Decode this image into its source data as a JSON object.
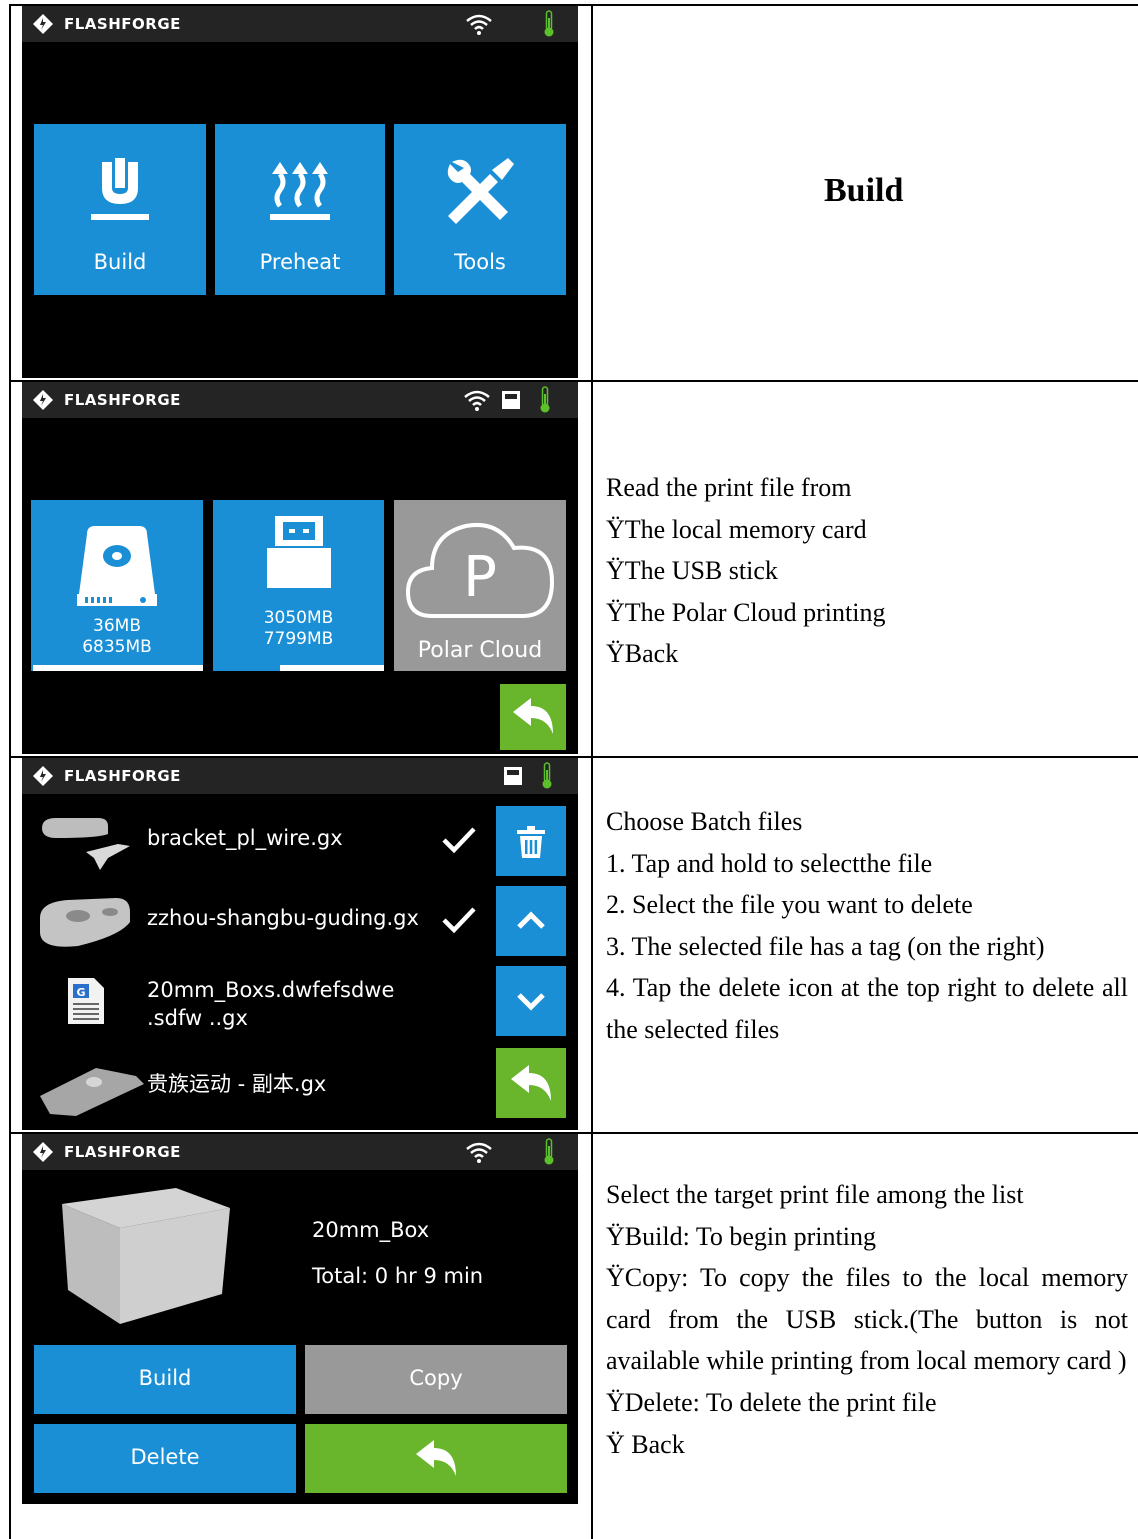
{
  "brand": "FLASHFORGE",
  "colors": {
    "blue": "#1b8fd6",
    "green": "#69b62c",
    "grey": "#999999"
  },
  "row1": {
    "tiles": [
      {
        "label": "Build",
        "icon": "build-icon"
      },
      {
        "label": "Preheat",
        "icon": "heat-icon"
      },
      {
        "label": "Tools",
        "icon": "tools-icon"
      }
    ],
    "title": "Build"
  },
  "row2": {
    "storage": [
      {
        "icon": "memory-card-icon",
        "used": "36MB",
        "total": "6835MB",
        "usage_fraction": 0.01
      },
      {
        "icon": "usb-icon",
        "used": "3050MB",
        "total": "7799MB",
        "usage_fraction": 0.39
      },
      {
        "icon": "polar-cloud-icon",
        "label": "Polar Cloud",
        "cloud_letter": "P"
      }
    ],
    "lines": [
      "Read the print file from",
      "ŸThe local memory card",
      "ŸThe USB stick",
      "ŸThe Polar Cloud printing",
      "ŸBack"
    ]
  },
  "row3": {
    "files": [
      {
        "name": "bracket_pl_wire.gx",
        "selected": true
      },
      {
        "name": "zzhou-shangbu-guding.gx",
        "selected": true
      },
      {
        "name_line1": "20mm_Boxs.dwfefsdwe",
        "name_line2": ".sdfw ..gx",
        "selected": false
      },
      {
        "name": "贵族运动 - 副本.gx",
        "selected": false
      }
    ],
    "title": "Choose Batch files",
    "steps": [
      "1. Tap and hold to selectthe file",
      "2. Select the file you want to delete",
      "3. The selected file has a tag (on the right)",
      "4. Tap the delete icon at the top right to delete all the selected files"
    ]
  },
  "row4": {
    "file_name": "20mm_Box",
    "total_time": "Total: 0 hr 9 min",
    "buttons": {
      "build": "Build",
      "copy": "Copy",
      "delete": "Delete"
    },
    "intro": "Select the target print file among the list",
    "items": [
      "ŸBuild: To begin printing",
      "ŸCopy: To copy the files to the local memory card from the USB stick.(The button is not available while printing from local memory card )",
      "ŸDelete: To delete the print file",
      "Ÿ Back"
    ]
  }
}
